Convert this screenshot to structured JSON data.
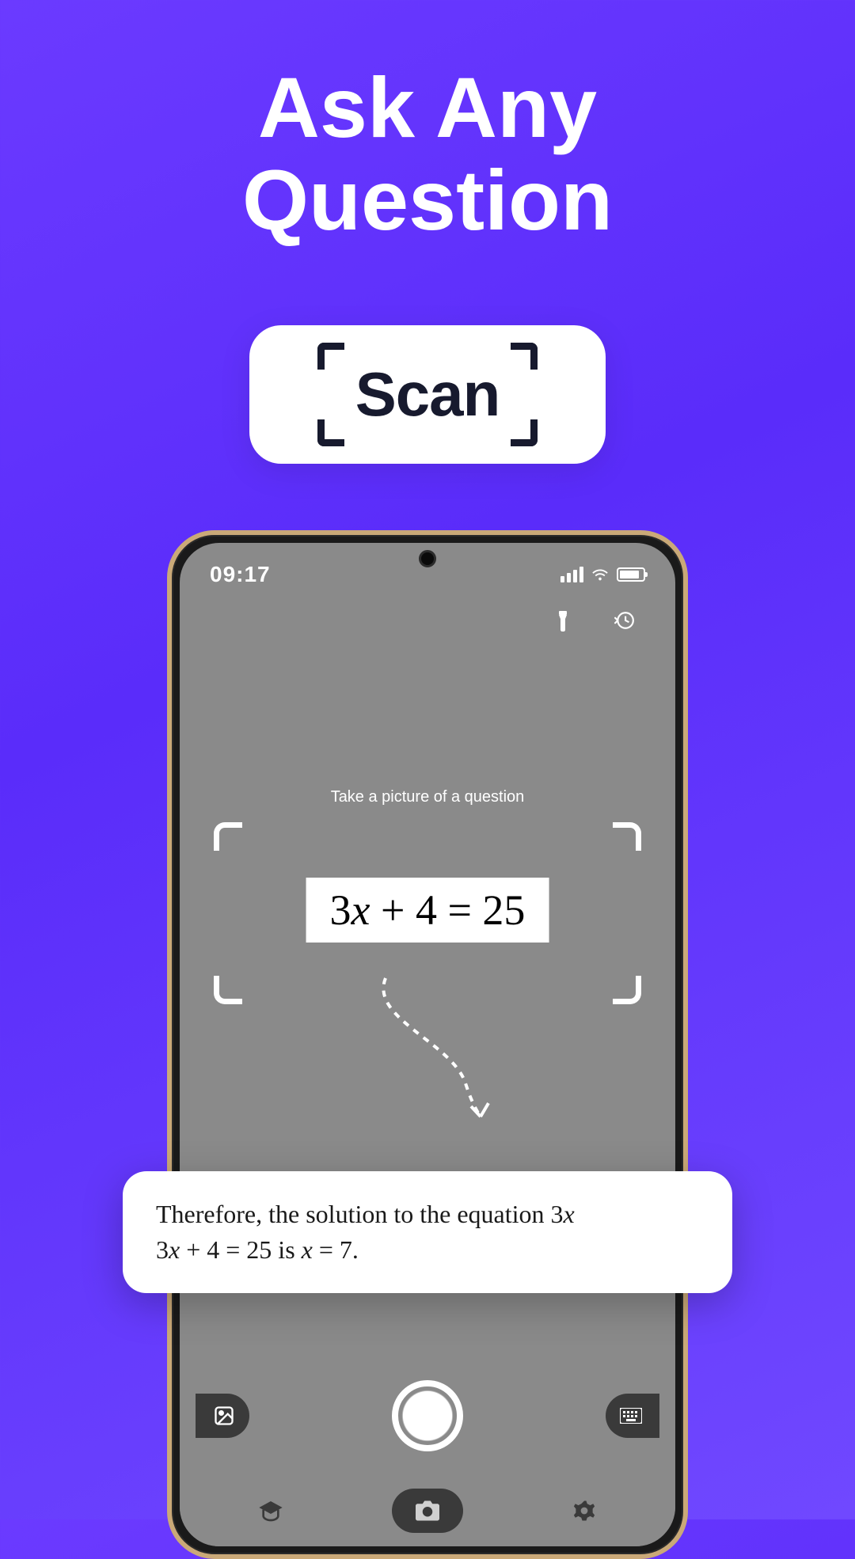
{
  "headline": {
    "line1": "Ask Any",
    "line2": "Question"
  },
  "scan_pill": {
    "label": "Scan"
  },
  "phone": {
    "status": {
      "time": "09:17"
    },
    "top_icons": {
      "flashlight": "flashlight-icon",
      "history": "history-icon"
    },
    "scan_hint": "Take a picture of a question",
    "equation": "3x + 4 = 25",
    "answer": {
      "prefix": "Therefore, the solution to the equation ",
      "eq1_lead": "3x",
      "eq1": "3x + 4 = 25",
      "mid": " is ",
      "eq2": "x = 7",
      "suffix": "."
    },
    "controls": {
      "gallery": "gallery-icon",
      "shutter": "shutter-button",
      "keyboard": "keyboard-icon"
    },
    "nav": {
      "left": "education-icon",
      "center": "camera-icon",
      "right": "settings-icon"
    }
  }
}
